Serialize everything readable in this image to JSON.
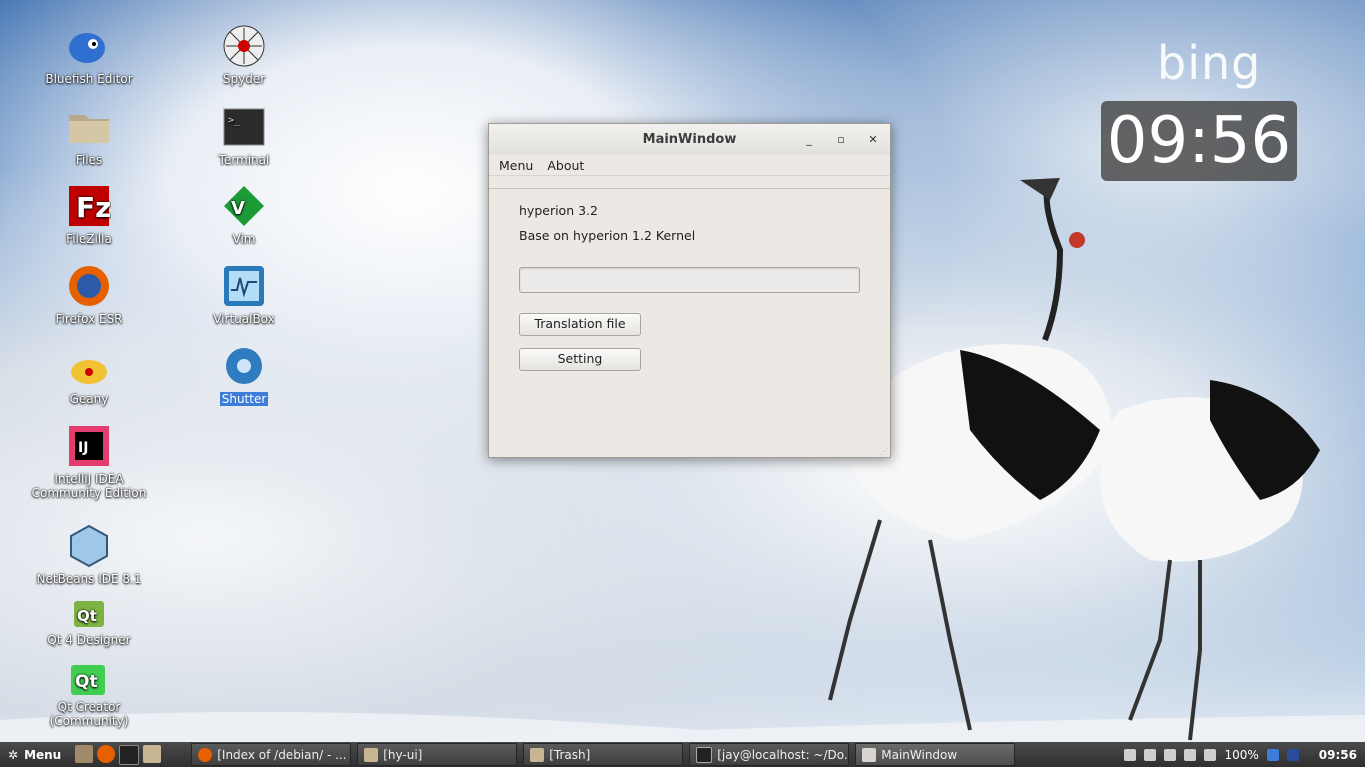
{
  "desktop": {
    "icons_col1": [
      {
        "label": "Bluefish Editor"
      },
      {
        "label": "Files"
      },
      {
        "label": "FileZilla"
      },
      {
        "label": "Firefox ESR"
      },
      {
        "label": "Geany"
      },
      {
        "label": "IntelliJ IDEA Community Edition"
      },
      {
        "label": "NetBeans IDE 8.1"
      },
      {
        "label": "Qt 4 Designer"
      },
      {
        "label": "Qt Creator (Community)"
      }
    ],
    "icons_col2": [
      {
        "label": "Spyder"
      },
      {
        "label": "Terminal"
      },
      {
        "label": "Vim"
      },
      {
        "label": "VirtualBox"
      },
      {
        "label": "Shutter"
      }
    ],
    "bing": "bing",
    "clock": "09:56"
  },
  "window": {
    "title": "MainWindow",
    "menu": [
      "Menu",
      "About"
    ],
    "text1": "hyperion 3.2",
    "text2": "Base on hyperion 1.2 Kernel",
    "input_value": "",
    "button1": "Translation file",
    "button2": "Setting"
  },
  "taskbar": {
    "menu_label": "Menu",
    "tasks": [
      {
        "label": "[Index of /debian/ - ..."
      },
      {
        "label": "[hy-ui]"
      },
      {
        "label": "[Trash]"
      },
      {
        "label": "[jay@localhost: ~/Do..."
      },
      {
        "label": "MainWindow"
      }
    ],
    "battery": "100%",
    "time": "09:56"
  }
}
